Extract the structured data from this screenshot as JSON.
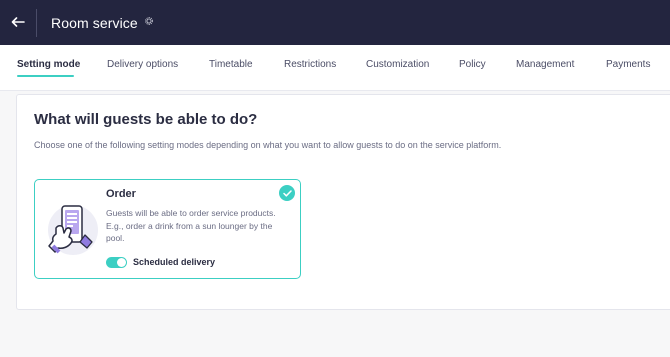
{
  "header": {
    "title": "Room service",
    "back_icon": "arrow-left-icon",
    "settings_icon": "gear-icon"
  },
  "tabs": [
    {
      "label": "Setting mode",
      "active": true
    },
    {
      "label": "Delivery options",
      "active": false
    },
    {
      "label": "Timetable",
      "active": false
    },
    {
      "label": "Restrictions",
      "active": false
    },
    {
      "label": "Customization",
      "active": false
    },
    {
      "label": "Policy",
      "active": false
    },
    {
      "label": "Management",
      "active": false
    },
    {
      "label": "Payments",
      "active": false
    }
  ],
  "main": {
    "heading": "What will guests be able to do?",
    "subtext": "Choose one of the following setting modes depending on what you want to allow guests to do on the service platform."
  },
  "mode_card": {
    "title": "Order",
    "description": "Guests will be able to order service products. E.g., order a drink from a sun lounger by the pool.",
    "selected": true,
    "check_icon": "check-circle-icon",
    "illustration_icon": "hand-phone-icon",
    "toggle_label": "Scheduled delivery",
    "toggle_on": true
  },
  "colors": {
    "topbar": "#23253f",
    "accent": "#3ccfc3",
    "text_primary": "#2b2d42",
    "text_secondary": "#6b6d84"
  }
}
